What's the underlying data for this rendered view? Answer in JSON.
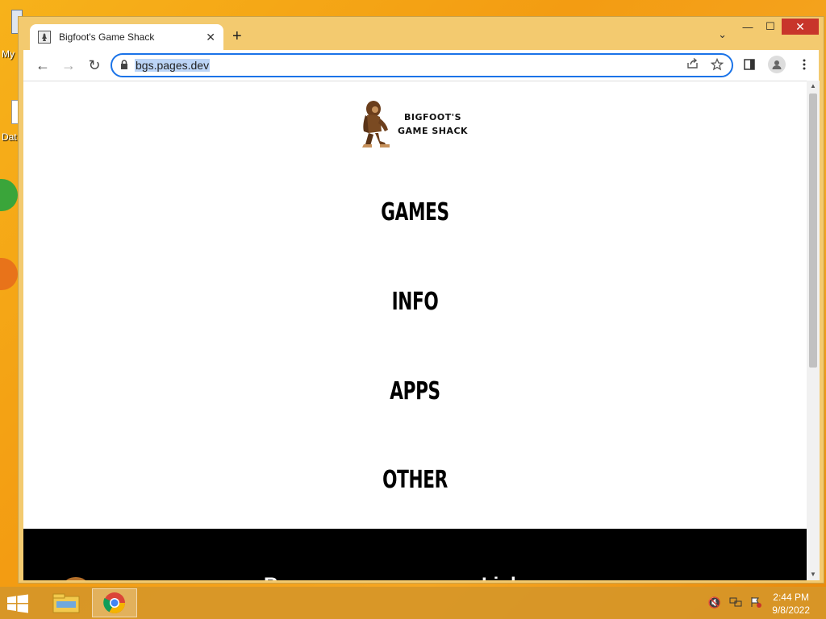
{
  "desktop": {
    "icon_labels": [
      "My",
      "Dat"
    ]
  },
  "browser": {
    "tab": {
      "title": "Bigfoot's Game Shack",
      "close": "✕"
    },
    "new_tab": "+",
    "tab_search": "⌄",
    "window_controls": {
      "minimize": "—",
      "maximize": "☐",
      "close": "✕"
    },
    "nav": {
      "back": "←",
      "forward": "→",
      "reload": "↻"
    },
    "omnibox": {
      "url": "bgs.pages.dev"
    }
  },
  "page": {
    "logo_line1": "BIGFOOT'S",
    "logo_line2": "GAME SHACK",
    "menu": [
      "GAMES",
      "INFO",
      "APPS",
      "OTHER"
    ],
    "footer": {
      "col1": "Resources",
      "col2": "Links"
    }
  },
  "taskbar": {
    "time": "2:44 PM",
    "date": "9/8/2022"
  },
  "colors": {
    "accent": "#1a73e8",
    "close_button": "#c8352b",
    "desktop": "#f39c12"
  }
}
